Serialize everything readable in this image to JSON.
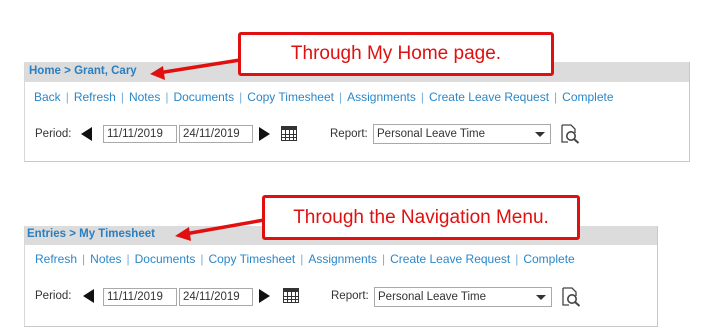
{
  "panel1": {
    "breadcrumb": {
      "home": "Home",
      "separator": " > ",
      "current": "Grant, Cary"
    },
    "toolbar": [
      "Back",
      "Refresh",
      "Notes",
      "Documents",
      "Copy Timesheet",
      "Assignments",
      "Create Leave Request",
      "Complete"
    ],
    "period_label": "Period:",
    "start_date": "11/11/2019",
    "end_date": "24/11/2019",
    "report_label": "Report:",
    "report_value": "Personal Leave Time"
  },
  "panel2": {
    "breadcrumb": {
      "home": "Entries",
      "separator": " > ",
      "current": "My Timesheet"
    },
    "toolbar": [
      "Refresh",
      "Notes",
      "Documents",
      "Copy Timesheet",
      "Assignments",
      "Create Leave Request",
      "Complete"
    ],
    "period_label": "Period:",
    "start_date": "11/11/2019",
    "end_date": "24/11/2019",
    "report_label": "Report:",
    "report_value": "Personal Leave Time"
  },
  "callouts": {
    "top": "Through My Home page.",
    "bottom": "Through the Navigation Menu."
  },
  "colors": {
    "link": "#2a87c8",
    "callout": "#e01010",
    "header_bar": "#dcdcdc"
  },
  "icons": [
    "arrow-left-icon",
    "arrow-right-icon",
    "calendar-icon",
    "magnifier-report-icon",
    "dropdown-caret-icon"
  ]
}
